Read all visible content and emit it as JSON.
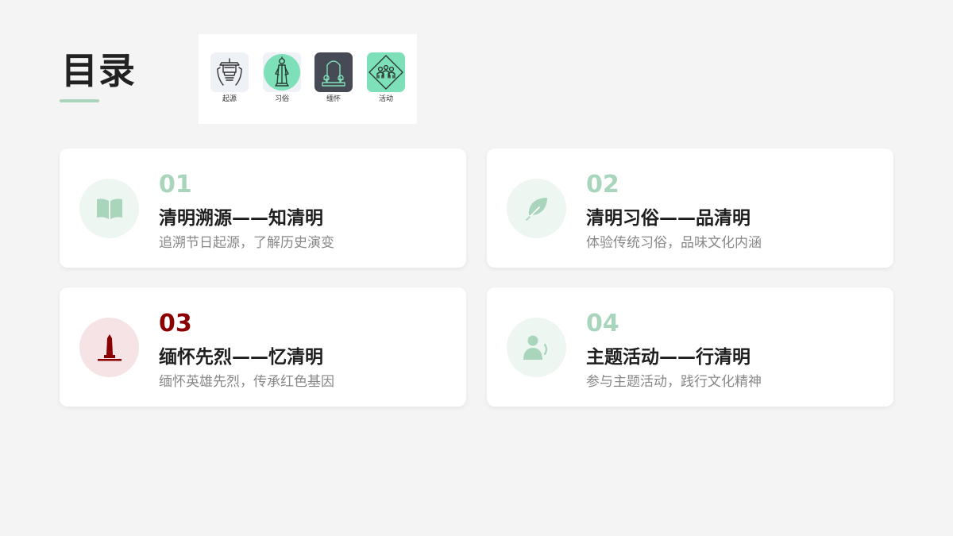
{
  "header": {
    "title": "目录"
  },
  "icon_strip": {
    "items": [
      {
        "label": "起源",
        "icon": "pavilion-hands-icon"
      },
      {
        "label": "习俗",
        "icon": "robed-figure-icon"
      },
      {
        "label": "缅怀",
        "icon": "tomb-flowers-icon"
      },
      {
        "label": "活动",
        "icon": "crowd-diamond-icon"
      }
    ]
  },
  "cards": [
    {
      "number": "01",
      "title": "清明溯源——知清明",
      "subtitle": "追溯节日起源，了解历史演变",
      "icon": "book-icon",
      "number_color": "#a8d5bc",
      "circle_color": "#eef6f1",
      "icon_color": "#a8d5bc"
    },
    {
      "number": "02",
      "title": "清明习俗——品清明",
      "subtitle": "体验传统习俗，品味文化内涵",
      "icon": "leaf-icon",
      "number_color": "#a8d5bc",
      "circle_color": "#eef6f1",
      "icon_color": "#a8d5bc"
    },
    {
      "number": "03",
      "title": "缅怀先烈——忆清明",
      "subtitle": "缅怀英雄先烈，传承红色基因",
      "icon": "monument-icon",
      "number_color": "#8b0000",
      "circle_color": "#f5e3e5",
      "icon_color": "#8b0000"
    },
    {
      "number": "04",
      "title": "主题活动——行清明",
      "subtitle": "参与主题活动，践行文化精神",
      "icon": "speaking-person-icon",
      "number_color": "#a8d5bc",
      "circle_color": "#eef6f1",
      "icon_color": "#a8d5bc"
    }
  ],
  "colors": {
    "accent_green": "#a8d5bc",
    "accent_red": "#8b0000",
    "mint": "#7ee0b8",
    "dark_tile": "#454a55"
  }
}
